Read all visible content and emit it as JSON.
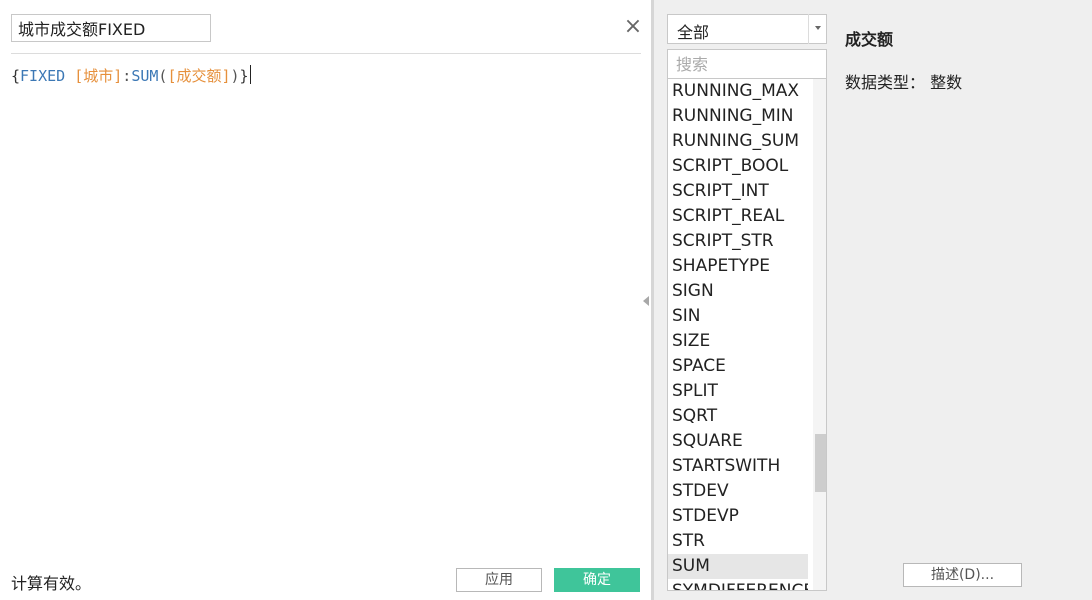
{
  "editor": {
    "calc_name": "城市成交额FIXED",
    "close_symbol": "×",
    "formula": {
      "open_brace": "{",
      "keyword": "FIXED",
      "space": " ",
      "dim_field": "[城市]",
      "colon": ":",
      "agg_fn": "SUM",
      "open_paren": "(",
      "measure_field": "[成交额]",
      "close_paren": ")",
      "close_brace": "}"
    },
    "status": "计算有效。",
    "apply_label": "应用",
    "ok_label": "确定"
  },
  "functions_panel": {
    "category": "全部",
    "search_placeholder": "搜索",
    "items": [
      "RUNNING_MAX",
      "RUNNING_MIN",
      "RUNNING_SUM",
      "SCRIPT_BOOL",
      "SCRIPT_INT",
      "SCRIPT_REAL",
      "SCRIPT_STR",
      "SHAPETYPE",
      "SIGN",
      "SIN",
      "SIZE",
      "SPACE",
      "SPLIT",
      "SQRT",
      "SQUARE",
      "STARTSWITH",
      "STDEV",
      "STDEVP",
      "STR",
      "SUM",
      "SYMDIFFERENCE"
    ],
    "selected_item": "SUM"
  },
  "detail": {
    "title": "成交额",
    "data_type": "数据类型： 整数",
    "describe_label": "描述(D)..."
  },
  "colors": {
    "ok_button": "#3fc59a",
    "keyword": "#3c78b5",
    "field": "#e6903c",
    "right_pane_bg": "#efefef"
  }
}
